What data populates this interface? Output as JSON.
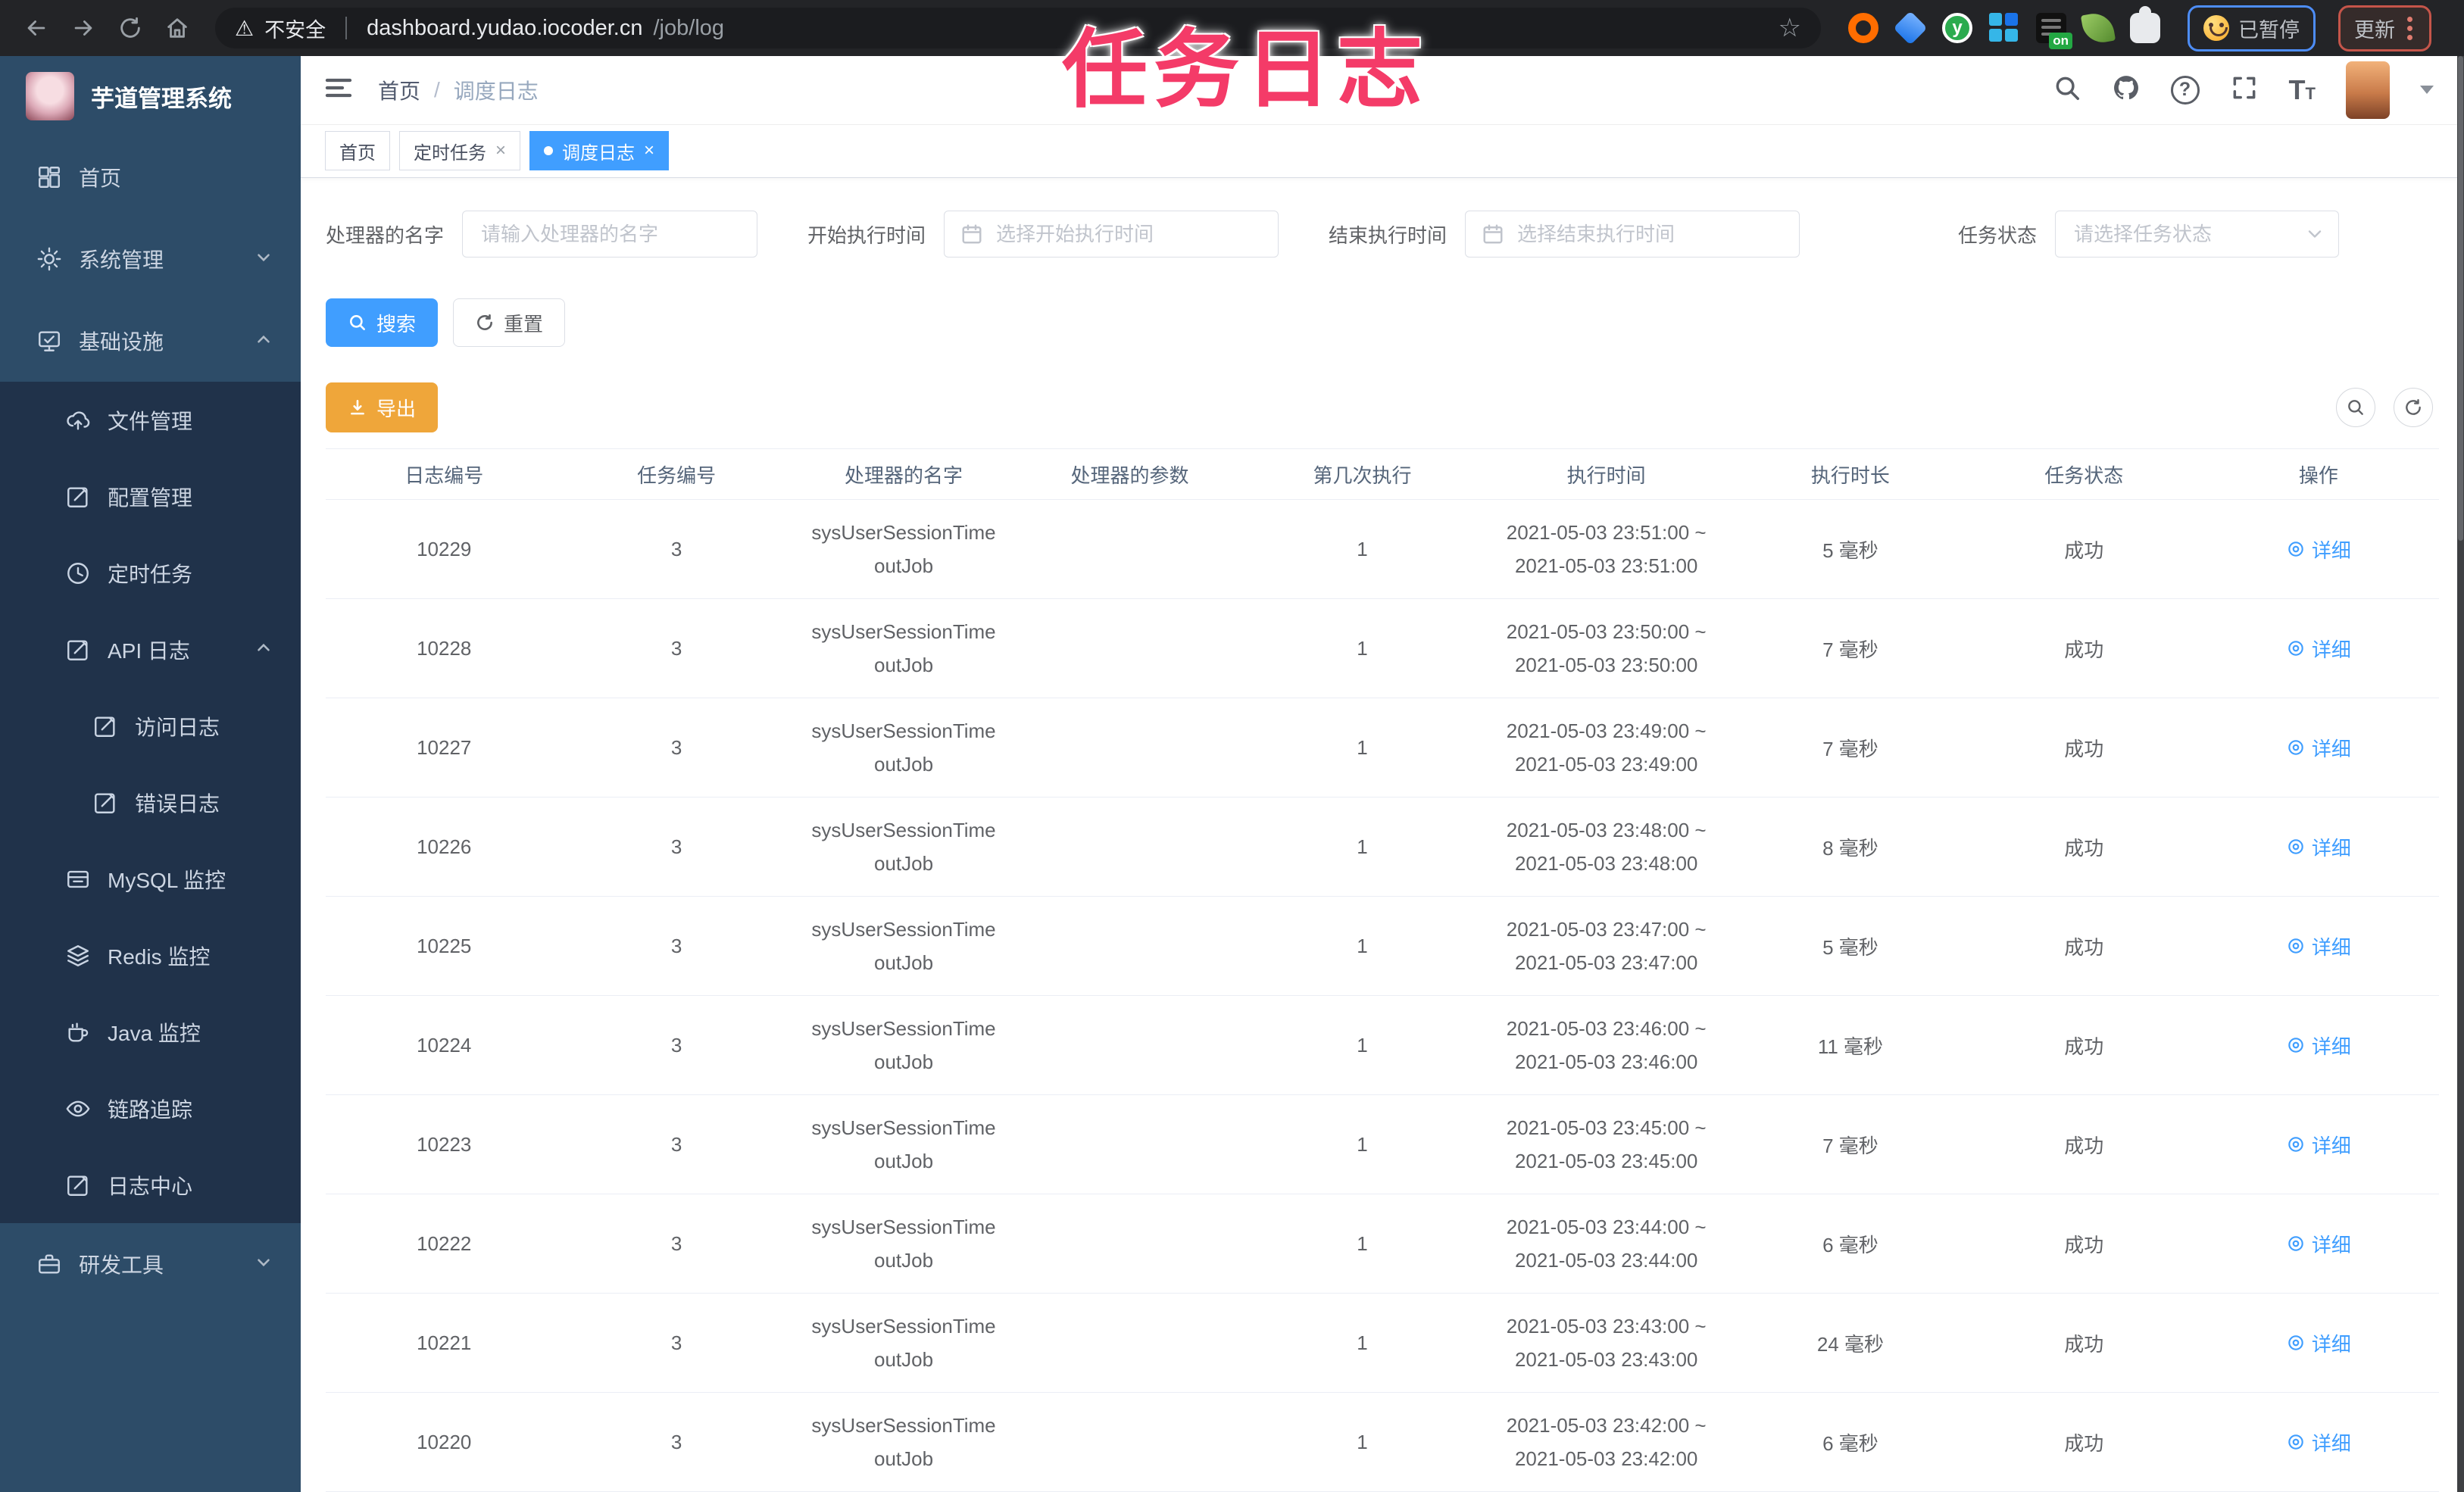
{
  "colors": {
    "accent_blue": "#409eff",
    "warning_orange": "#efa63a",
    "overlay_pink": "#f43b68",
    "sidebar_bg": "#2d4c68",
    "sidebar_submenu_bg": "#20324a",
    "browser_bar_bg": "#232427"
  },
  "browser": {
    "security_label": "不安全",
    "url_host": "dashboard.yudao.iocoder.cn",
    "url_path": "/job/log",
    "paused_chip_label": "已暂停",
    "update_chip_label": "更新",
    "extension_on_badge": "on"
  },
  "overlay": {
    "title": "任务日志"
  },
  "sidebar": {
    "app_title": "芋道管理系统",
    "items": [
      {
        "label": "首页"
      },
      {
        "label": "系统管理"
      },
      {
        "label": "基础设施"
      },
      {
        "label": "文件管理"
      },
      {
        "label": "配置管理"
      },
      {
        "label": "定时任务"
      },
      {
        "label": "API 日志"
      },
      {
        "label": "访问日志"
      },
      {
        "label": "错误日志"
      },
      {
        "label": "MySQL 监控"
      },
      {
        "label": "Redis 监控"
      },
      {
        "label": "Java 监控"
      },
      {
        "label": "链路追踪"
      },
      {
        "label": "日志中心"
      },
      {
        "label": "研发工具"
      }
    ]
  },
  "header": {
    "breadcrumb_home": "首页",
    "breadcrumb_separator": "/",
    "breadcrumb_current": "调度日志",
    "help_glyph": "?"
  },
  "tags": {
    "close_glyph": "×",
    "items": [
      {
        "label": "首页"
      },
      {
        "label": "定时任务"
      },
      {
        "label": "调度日志"
      }
    ]
  },
  "filters": {
    "handler_name": {
      "label": "处理器的名字",
      "placeholder": "请输入处理器的名字"
    },
    "begin_time": {
      "label": "开始执行时间",
      "placeholder": "选择开始执行时间"
    },
    "end_time": {
      "label": "结束执行时间",
      "placeholder": "选择结束执行时间"
    },
    "status": {
      "label": "任务状态",
      "placeholder": "请选择任务状态"
    }
  },
  "actions": {
    "search": "搜索",
    "reset": "重置",
    "export": "导出"
  },
  "table": {
    "columns": [
      "日志编号",
      "任务编号",
      "处理器的名字",
      "处理器的参数",
      "第几次执行",
      "执行时间",
      "执行时长",
      "任务状态",
      "操作"
    ],
    "action_label": "详细",
    "rows": [
      {
        "log_id": "10229",
        "job_id": "3",
        "handler_name": "sysUserSessionTimeoutJob",
        "handler_param": "",
        "execute_index": "1",
        "exec_time": [
          "2021-05-03 23:51:00 ~",
          "2021-05-03 23:51:00"
        ],
        "duration": "5 毫秒",
        "status": "成功"
      },
      {
        "log_id": "10228",
        "job_id": "3",
        "handler_name": "sysUserSessionTimeoutJob",
        "handler_param": "",
        "execute_index": "1",
        "exec_time": [
          "2021-05-03 23:50:00 ~",
          "2021-05-03 23:50:00"
        ],
        "duration": "7 毫秒",
        "status": "成功"
      },
      {
        "log_id": "10227",
        "job_id": "3",
        "handler_name": "sysUserSessionTimeoutJob",
        "handler_param": "",
        "execute_index": "1",
        "exec_time": [
          "2021-05-03 23:49:00 ~",
          "2021-05-03 23:49:00"
        ],
        "duration": "7 毫秒",
        "status": "成功"
      },
      {
        "log_id": "10226",
        "job_id": "3",
        "handler_name": "sysUserSessionTimeoutJob",
        "handler_param": "",
        "execute_index": "1",
        "exec_time": [
          "2021-05-03 23:48:00 ~",
          "2021-05-03 23:48:00"
        ],
        "duration": "8 毫秒",
        "status": "成功"
      },
      {
        "log_id": "10225",
        "job_id": "3",
        "handler_name": "sysUserSessionTimeoutJob",
        "handler_param": "",
        "execute_index": "1",
        "exec_time": [
          "2021-05-03 23:47:00 ~",
          "2021-05-03 23:47:00"
        ],
        "duration": "5 毫秒",
        "status": "成功"
      },
      {
        "log_id": "10224",
        "job_id": "3",
        "handler_name": "sysUserSessionTimeoutJob",
        "handler_param": "",
        "execute_index": "1",
        "exec_time": [
          "2021-05-03 23:46:00 ~",
          "2021-05-03 23:46:00"
        ],
        "duration": "11 毫秒",
        "status": "成功"
      },
      {
        "log_id": "10223",
        "job_id": "3",
        "handler_name": "sysUserSessionTimeoutJob",
        "handler_param": "",
        "execute_index": "1",
        "exec_time": [
          "2021-05-03 23:45:00 ~",
          "2021-05-03 23:45:00"
        ],
        "duration": "7 毫秒",
        "status": "成功"
      },
      {
        "log_id": "10222",
        "job_id": "3",
        "handler_name": "sysUserSessionTimeoutJob",
        "handler_param": "",
        "execute_index": "1",
        "exec_time": [
          "2021-05-03 23:44:00 ~",
          "2021-05-03 23:44:00"
        ],
        "duration": "6 毫秒",
        "status": "成功"
      },
      {
        "log_id": "10221",
        "job_id": "3",
        "handler_name": "sysUserSessionTimeoutJob",
        "handler_param": "",
        "execute_index": "1",
        "exec_time": [
          "2021-05-03 23:43:00 ~",
          "2021-05-03 23:43:00"
        ],
        "duration": "24 毫秒",
        "status": "成功"
      },
      {
        "log_id": "10220",
        "job_id": "3",
        "handler_name": "sysUserSessionTimeoutJob",
        "handler_param": "",
        "execute_index": "1",
        "exec_time": [
          "2021-05-03 23:42:00 ~",
          "2021-05-03 23:42:00"
        ],
        "duration": "6 毫秒",
        "status": "成功"
      }
    ]
  }
}
